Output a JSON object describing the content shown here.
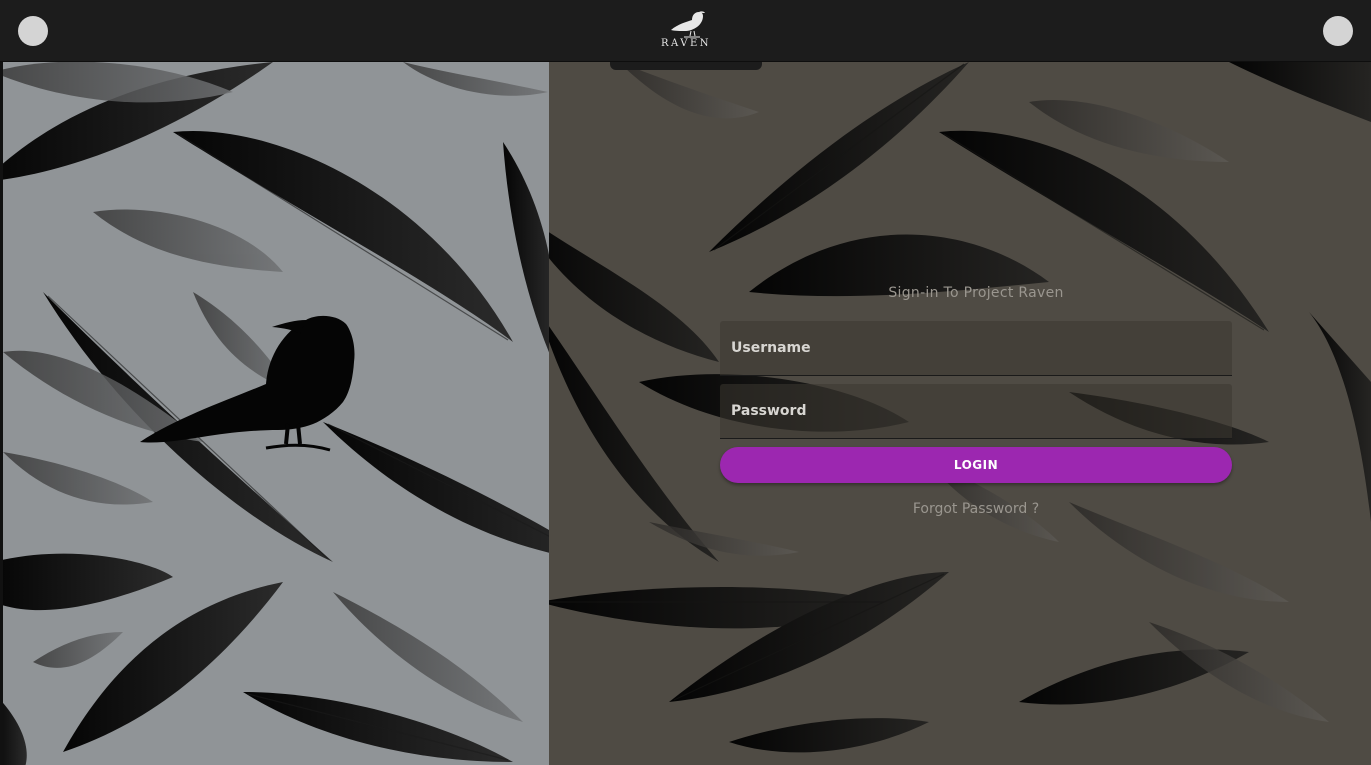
{
  "header": {
    "logo_text": "RAVEN",
    "left_button_icon": "circle-icon",
    "right_button_icon": "circle-icon"
  },
  "login": {
    "title": "Sign-in To Project Raven",
    "username_placeholder": "Username",
    "password_placeholder": "Password",
    "login_label": "LOGIN",
    "forgot_label": "Forgot Password ?"
  },
  "colors": {
    "accent": "#9c27b0",
    "topbar": "#1c1c1c",
    "left_panel": "#909497",
    "right_panel": "#4f4b44"
  },
  "icons": {
    "logo": "raven-icon",
    "illustration": "raven-silhouette-icon",
    "background": "feather-pattern"
  }
}
